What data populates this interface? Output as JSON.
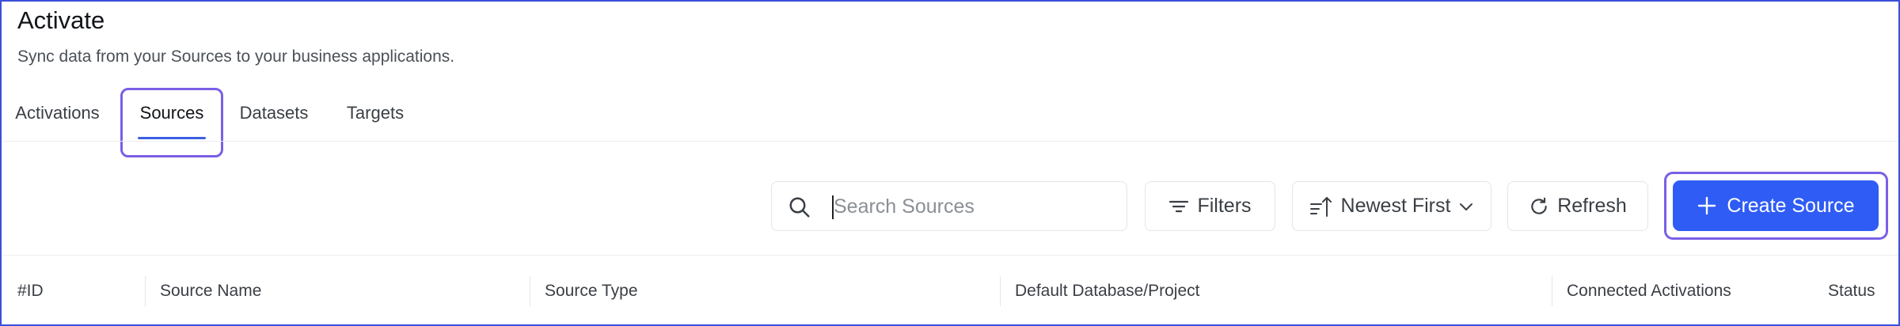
{
  "header": {
    "title": "Activate",
    "subtitle": "Sync data from your Sources to your business applications."
  },
  "tabs": [
    {
      "label": "Activations",
      "active": false
    },
    {
      "label": "Sources",
      "active": true
    },
    {
      "label": "Datasets",
      "active": false
    },
    {
      "label": "Targets",
      "active": false
    }
  ],
  "toolbar": {
    "search_placeholder": "Search Sources",
    "search_value": "",
    "filters_label": "Filters",
    "sort_label": "Newest First",
    "refresh_label": "Refresh",
    "create_label": "Create Source"
  },
  "table": {
    "columns": [
      "#ID",
      "Source Name",
      "Source Type",
      "Default Database/Project",
      "Connected Activations",
      "Status"
    ]
  },
  "colors": {
    "accent": "#2f5cf5",
    "highlight": "#7a5fe6",
    "tab_underline": "#3c5fe3"
  },
  "icons": [
    "search-icon",
    "filter-icon",
    "sort-icon",
    "chevron-down-icon",
    "refresh-icon",
    "plus-icon"
  ]
}
